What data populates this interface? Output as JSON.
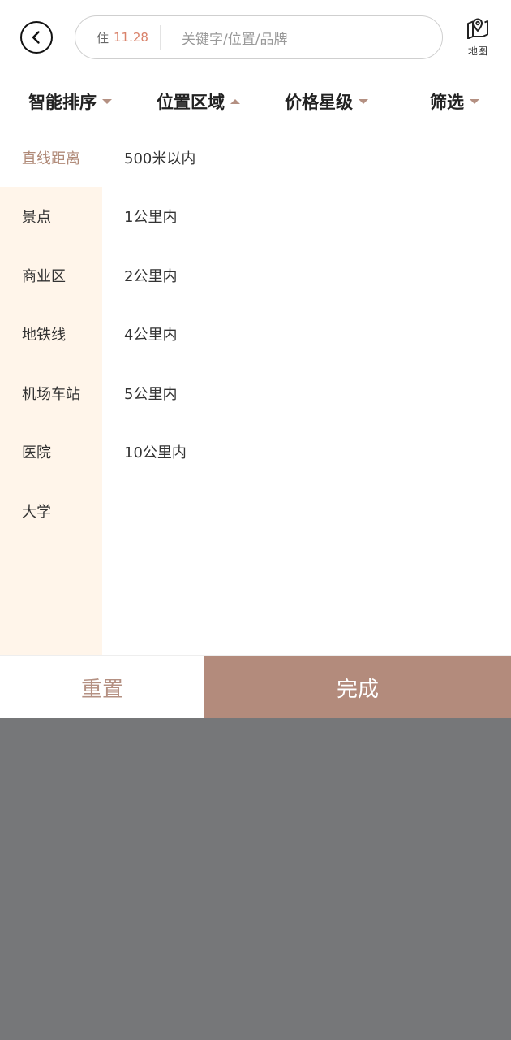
{
  "header": {
    "stay_prefix": "住",
    "stay_date": "11.28",
    "search_placeholder": "关键字/位置/品牌",
    "map_label": "地图"
  },
  "filters": [
    {
      "label": "智能排序",
      "caret": "down"
    },
    {
      "label": "位置区域",
      "caret": "up"
    },
    {
      "label": "价格星级",
      "caret": "down"
    },
    {
      "label": "筛选",
      "caret": "down"
    }
  ],
  "categories": [
    "直线距离",
    "景点",
    "商业区",
    "地铁线",
    "机场车站",
    "医院",
    "大学"
  ],
  "active_category": "直线距离",
  "options": [
    "500米以内",
    "1公里内",
    "2公里内",
    "4公里内",
    "5公里内",
    "10公里内"
  ],
  "actions": {
    "reset": "重置",
    "done": "完成"
  },
  "colors": {
    "accent": "#b38b7c",
    "accent_text": "#b08a78",
    "date": "#d9826a",
    "category_bg": "#fff5ea",
    "overlay": "#767779"
  }
}
